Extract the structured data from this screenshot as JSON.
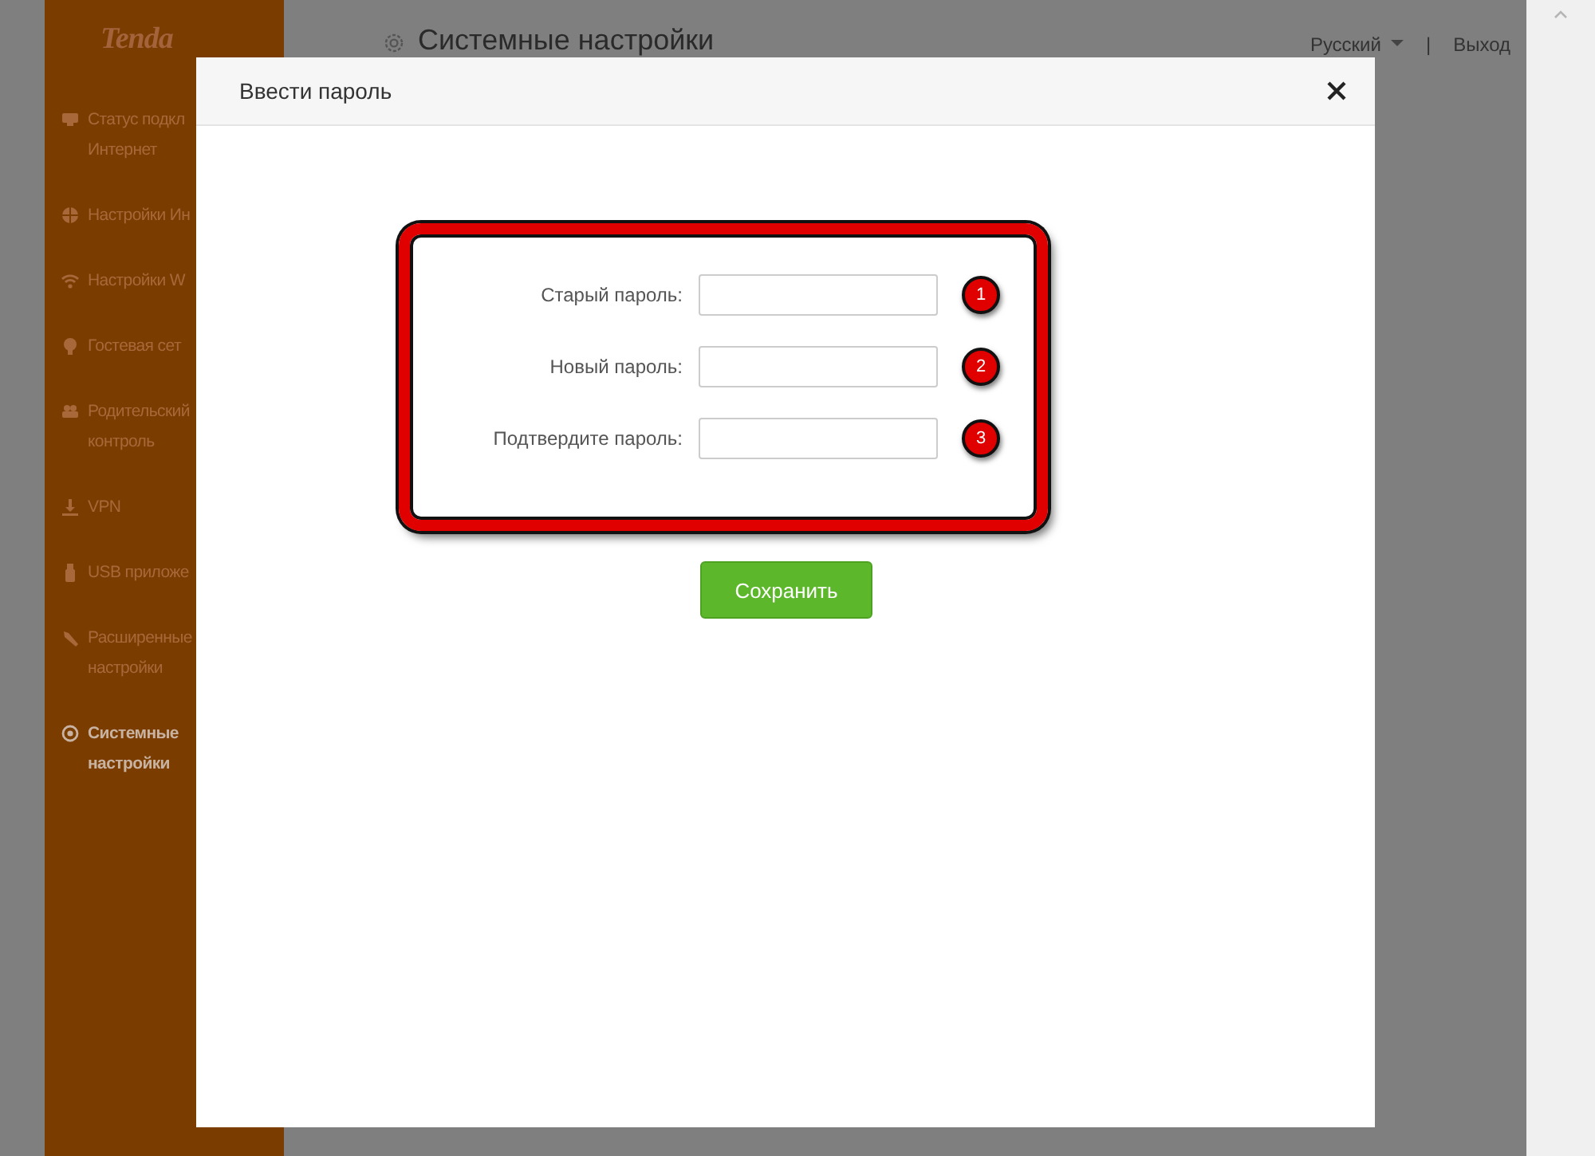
{
  "sidebar": {
    "logo": "Tenda",
    "items": [
      {
        "lines": [
          "Статус подкл",
          "Интернет"
        ],
        "selected": false
      },
      {
        "lines": [
          "Настройки Ин"
        ],
        "selected": false
      },
      {
        "lines": [
          "Настройки W"
        ],
        "selected": false
      },
      {
        "lines": [
          "Гостевая сет"
        ],
        "selected": false
      },
      {
        "lines": [
          "Родительский",
          "контроль"
        ],
        "selected": false
      },
      {
        "lines": [
          "VPN"
        ],
        "selected": false
      },
      {
        "lines": [
          "USB приложе"
        ],
        "selected": false
      },
      {
        "lines": [
          "Расширенные",
          "настройки"
        ],
        "selected": false
      },
      {
        "lines": [
          "Системные",
          "настройки"
        ],
        "selected": true
      }
    ]
  },
  "header": {
    "title": "Системные настройки",
    "language": "Русский",
    "separator": "|",
    "logout": "Выход"
  },
  "dialog": {
    "title": "Ввести пароль",
    "fields": [
      {
        "label": "Старый пароль:",
        "badge": "1"
      },
      {
        "label": "Новый пароль:",
        "badge": "2"
      },
      {
        "label": "Подтвердите пароль:",
        "badge": "3"
      }
    ],
    "save_button": "Сохранить"
  }
}
